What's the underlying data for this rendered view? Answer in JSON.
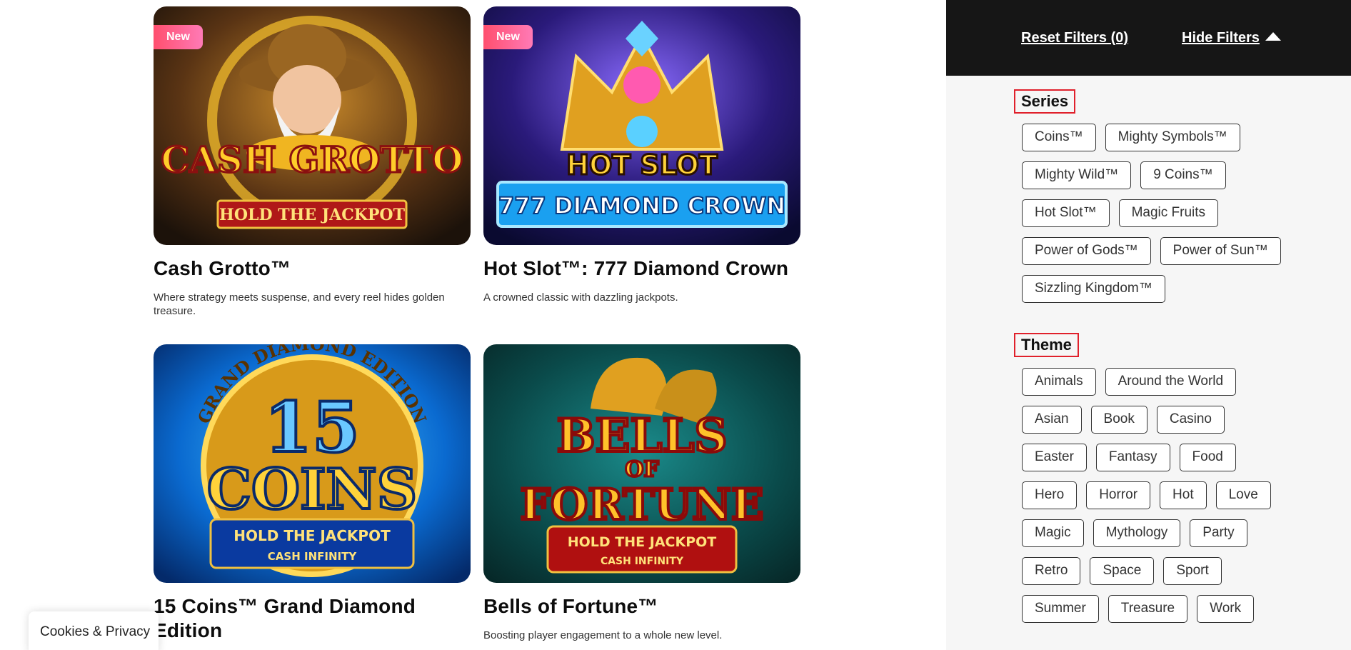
{
  "games": [
    {
      "title": "Cash Grotto™",
      "description": "Where strategy meets suspense, and every reel hides golden treasure.",
      "badge": "New",
      "art_line1": "CASH GROTTO",
      "art_line2": "HOLD THE JACKPOT"
    },
    {
      "title": "Hot Slot™: 777 Diamond Crown",
      "description": "A crowned classic with dazzling jackpots.",
      "badge": "New",
      "art_line1": "HOT SLOT",
      "art_line2": "777 DIAMOND CROWN"
    },
    {
      "title": "15 Coins™ Grand Diamond Edition",
      "description": "",
      "badge": "",
      "art_line1": "15",
      "art_line2": "COINS",
      "art_line3": "HOLD THE JACKPOT",
      "art_line4": "CASH INFINITY",
      "art_arc": "GRAND DIAMOND EDITION"
    },
    {
      "title": "Bells of Fortune™",
      "description": "Boosting player engagement to a whole new level.",
      "badge": "",
      "art_line1": "BELLS",
      "art_line2": "OF",
      "art_line3": "FORTUNE",
      "art_line4": "HOLD THE JACKPOT",
      "art_line5": "CASH INFINITY"
    }
  ],
  "cookies_label": "Cookies & Privacy",
  "filters": {
    "reset_label": "Reset Filters (0)",
    "hide_label": "Hide Filters",
    "series": {
      "title": "Series",
      "options": [
        "Coins™",
        "Mighty Symbols™",
        "Mighty Wild™",
        "9 Coins™",
        "Hot Slot™",
        "Magic Fruits",
        "Power of Gods™",
        "Power of Sun™",
        "Sizzling Kingdom™"
      ]
    },
    "theme": {
      "title": "Theme",
      "options": [
        "Animals",
        "Around the World",
        "Asian",
        "Book",
        "Casino",
        "Easter",
        "Fantasy",
        "Food",
        "Hero",
        "Horror",
        "Hot",
        "Love",
        "Magic",
        "Mythology",
        "Party",
        "Retro",
        "Space",
        "Sport",
        "Summer",
        "Treasure",
        "Work"
      ]
    }
  },
  "colors": {
    "badge": "#ff5a8a",
    "filter_header_bg": "#161616",
    "section_outline": "#e0202b"
  }
}
